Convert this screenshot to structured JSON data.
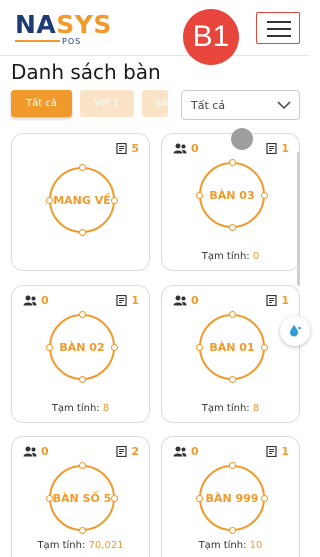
{
  "brand": {
    "logo_left": "NA",
    "logo_right": "SYS",
    "logo_sub": "POS"
  },
  "step_badge": "B1",
  "page_title": "Danh sách bàn",
  "tabs": [
    {
      "label": "Tất cả",
      "active": true
    },
    {
      "label": "VIP 1",
      "active": false
    },
    {
      "label": "SA",
      "active": false
    }
  ],
  "area_select": {
    "value": "Tất cả"
  },
  "subtotal_label": "Tạm tính:",
  "tables": [
    {
      "name": "MANG VỀ",
      "guests": null,
      "orders": "5",
      "subtotal": null
    },
    {
      "name": "BÀN 03",
      "guests": "0",
      "orders": "1",
      "subtotal": "0"
    },
    {
      "name": "BÀN 02",
      "guests": "0",
      "orders": "1",
      "subtotal": "8"
    },
    {
      "name": "BÀN 01",
      "guests": "0",
      "orders": "1",
      "subtotal": "8"
    },
    {
      "name": "BÀN SỐ 5",
      "guests": "0",
      "orders": "2",
      "subtotal": "70,021"
    },
    {
      "name": "BÀN 999",
      "guests": "0",
      "orders": "1",
      "subtotal": "10"
    }
  ],
  "colors": {
    "accent": "#f09a2b",
    "navy": "#1f3b73",
    "badge": "#e8453c"
  },
  "icons": {
    "guests": "users-icon",
    "orders": "receipt-icon",
    "menu": "hamburger-icon",
    "dropdown": "chevron-down-icon",
    "floating": "water-drop-icon"
  }
}
